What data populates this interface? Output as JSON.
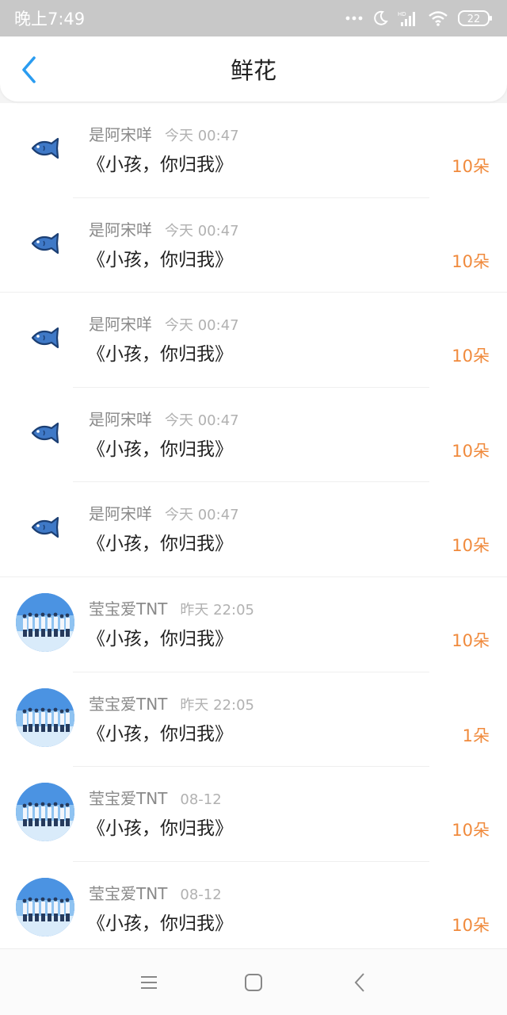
{
  "status_bar": {
    "time": "晚上7:49",
    "battery": "22",
    "icons": [
      "dots-icon",
      "moon-icon",
      "signal-icon",
      "wifi-icon",
      "battery-icon"
    ]
  },
  "header": {
    "title": "鲜花",
    "back_icon": "chevron-left-icon"
  },
  "records": [
    {
      "avatar": "fish",
      "name": "是阿宋咩",
      "time": "今天 00:47",
      "work": "《小孩，你归我》",
      "count": "10朵"
    },
    {
      "avatar": "fish",
      "name": "是阿宋咩",
      "time": "今天 00:47",
      "work": "《小孩，你归我》",
      "count": "10朵"
    },
    {
      "avatar": "fish",
      "name": "是阿宋咩",
      "time": "今天 00:47",
      "work": "《小孩，你归我》",
      "count": "10朵"
    },
    {
      "avatar": "fish",
      "name": "是阿宋咩",
      "time": "今天 00:47",
      "work": "《小孩，你归我》",
      "count": "10朵"
    },
    {
      "avatar": "fish",
      "name": "是阿宋咩",
      "time": "今天 00:47",
      "work": "《小孩，你归我》",
      "count": "10朵"
    },
    {
      "avatar": "photo",
      "name": "莹宝爱TNT",
      "time": "昨天 22:05",
      "work": "《小孩，你归我》",
      "count": "10朵"
    },
    {
      "avatar": "photo",
      "name": "莹宝爱TNT",
      "time": "昨天 22:05",
      "work": "《小孩，你归我》",
      "count": "1朵"
    },
    {
      "avatar": "photo",
      "name": "莹宝爱TNT",
      "time": "08-12",
      "work": "《小孩，你归我》",
      "count": "10朵"
    },
    {
      "avatar": "photo",
      "name": "莹宝爱TNT",
      "time": "08-12",
      "work": "《小孩，你归我》",
      "count": "10朵"
    }
  ],
  "nav_bar": {
    "buttons": [
      "menu-icon",
      "home-icon",
      "back-icon"
    ]
  },
  "colors": {
    "accent": "#f08a3c",
    "back_arrow": "#2a9cf0",
    "status_bar_bg": "#c8c8c8"
  }
}
